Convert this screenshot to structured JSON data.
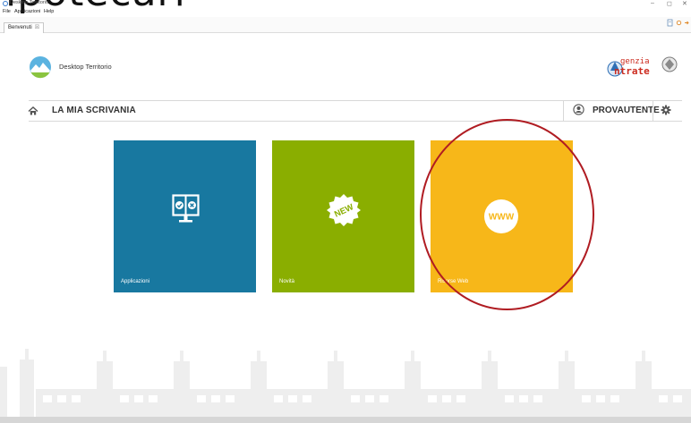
{
  "overlay_text": "ipotecari",
  "window": {
    "title": "Desktop Territorio",
    "controls": {
      "minimize": "–",
      "restore": "◻",
      "close": "✕"
    }
  },
  "menu": [
    "File",
    "Applicazioni",
    "Help"
  ],
  "tab": {
    "label": "Benvenuti",
    "close": "☒"
  },
  "header": {
    "app_name": "Desktop Territorio",
    "agency_line1": "genzia",
    "agency_line2": "ntrate"
  },
  "navbar": {
    "title": "LA MIA SCRIVANIA",
    "user": "PROVAUTENTE"
  },
  "tiles": [
    {
      "label": "Applicazioni",
      "color": "#1878a0"
    },
    {
      "label": "Novità",
      "color": "#8aae00",
      "badge": "NEW"
    },
    {
      "label": "Risorse Web",
      "color": "#f7b719",
      "badge": "WWW"
    }
  ],
  "colors": {
    "highlight": "#b01c22",
    "skyline": "#ececec"
  }
}
